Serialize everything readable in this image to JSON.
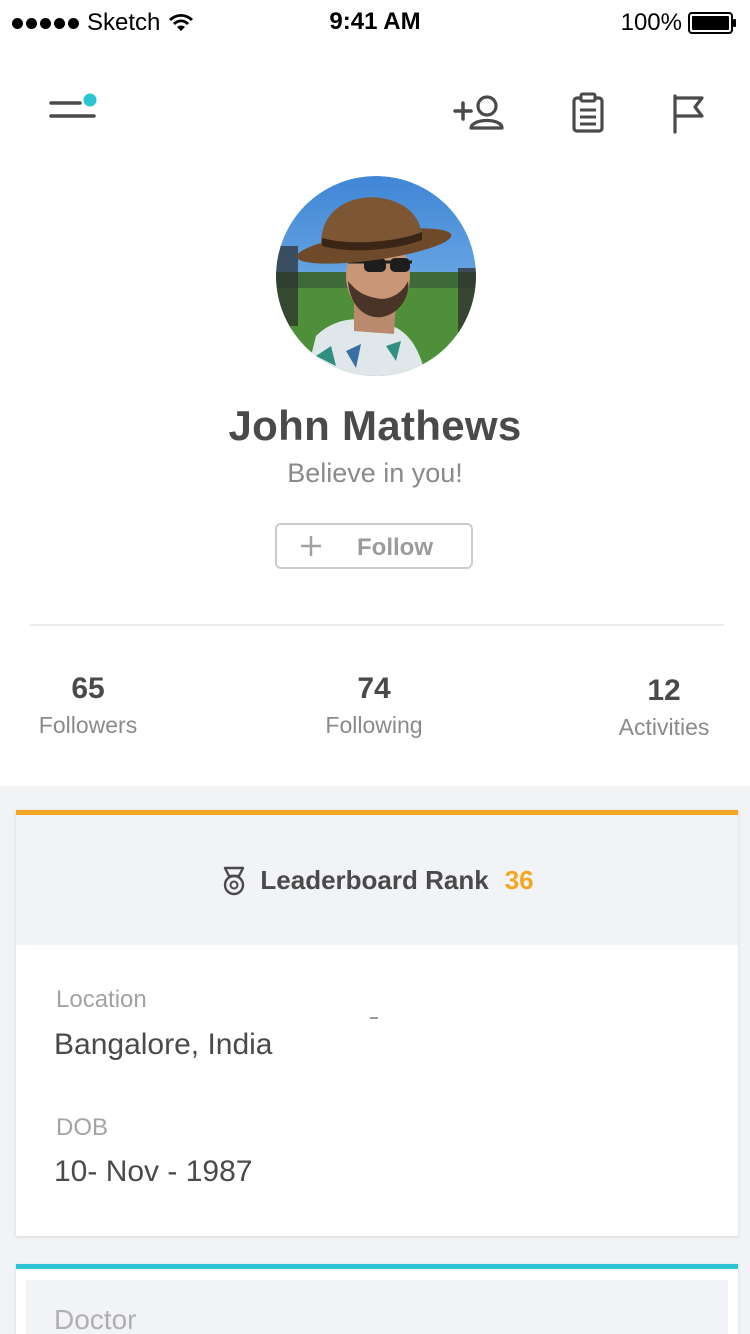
{
  "status_bar": {
    "carrier": "Sketch",
    "time": "9:41 AM",
    "battery": "100%"
  },
  "nav": {
    "menu_icon": "menu-icon",
    "add_friend_icon": "add-user-icon",
    "notes_icon": "clipboard-icon",
    "flag_icon": "flag-icon",
    "accent_color": "#2cc3d3"
  },
  "profile": {
    "name": "John Mathews",
    "bio": "Believe in you!",
    "follow_label": "Follow"
  },
  "stats": [
    {
      "value": "65",
      "label": "Followers"
    },
    {
      "value": "74",
      "label": "Following"
    },
    {
      "value": "12",
      "label": "Activities"
    }
  ],
  "leaderboard": {
    "label": "Leaderboard Rank",
    "rank": "36",
    "accent_color": "#f5a623"
  },
  "details": {
    "location_label": "Location",
    "location_value": "Bangalore, India",
    "dob_label": "DOB",
    "dob_value": "10- Nov - 1987"
  },
  "next_card": {
    "label": "Doctor",
    "accent_color": "#2cc3d3"
  }
}
